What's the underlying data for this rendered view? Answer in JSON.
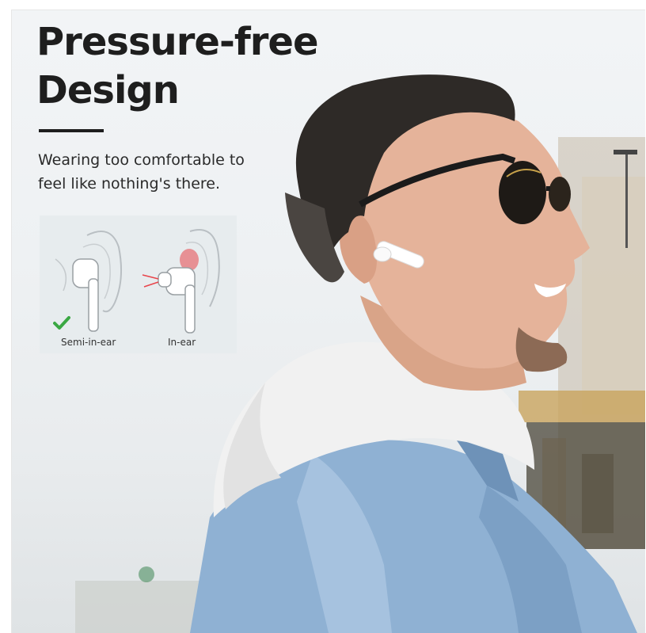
{
  "headline": {
    "line1": "Pressure-free",
    "line2": "Design"
  },
  "subtitle": {
    "line1": "Wearing too comfortable to",
    "line2": "feel like nothing's there."
  },
  "fit_options": [
    {
      "label": "Semi-in-ear",
      "selected": true,
      "icon": "checkmark-icon"
    },
    {
      "label": "In-ear",
      "selected": false
    }
  ],
  "colors": {
    "headline": "#1e1e1e",
    "check": "#3aa843",
    "pressure_highlight": "#e8454b",
    "jacket": "#8fb1d3",
    "hoodie": "#f1f1f1"
  }
}
